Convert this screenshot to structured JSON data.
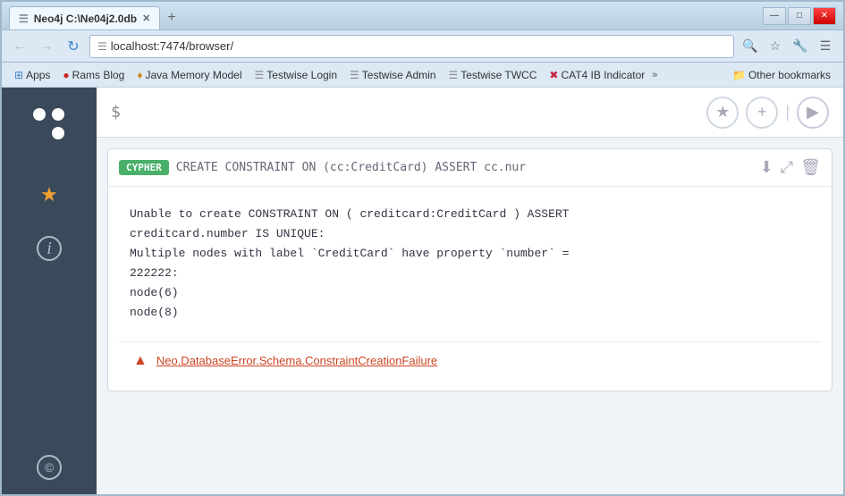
{
  "window": {
    "title": "Neo4j C:\\Ne04j2.0db",
    "tab_label": "Neo4j C:\\Ne04j2.0db",
    "url": "localhost:7474/browser/"
  },
  "bookmarks": {
    "items": [
      {
        "id": "apps",
        "icon": "⊞",
        "label": "Apps",
        "color": "#4488cc"
      },
      {
        "id": "rams-blog",
        "icon": "●",
        "label": "Rams Blog",
        "color": "#cc2222"
      },
      {
        "id": "java-memory",
        "icon": "♦",
        "label": "Java Memory Model",
        "color": "#cc8822"
      },
      {
        "id": "testwise-login",
        "icon": "☰",
        "label": "Testwise Login"
      },
      {
        "id": "testwise-admin",
        "icon": "☰",
        "label": "Testwise Admin"
      },
      {
        "id": "testwise-twcc",
        "icon": "☰",
        "label": "Testwise TWCC"
      },
      {
        "id": "cat4",
        "icon": "✖",
        "label": "CAT4 IB Indicator"
      }
    ],
    "more_label": "»",
    "folder_label": "Other bookmarks"
  },
  "sidebar": {
    "logo_alt": "Neo4j logo",
    "items": [
      {
        "id": "favorites",
        "icon": "★",
        "label": "Favorites",
        "active": true
      },
      {
        "id": "info",
        "icon": "ℹ",
        "label": "Info",
        "active": false
      }
    ],
    "bottom_icon": "©"
  },
  "query_bar": {
    "prompt": "$",
    "star_label": "★",
    "plus_label": "+",
    "play_label": "▶"
  },
  "result": {
    "cypher_badge": "CYPHER",
    "query_text": "CREATE CONSTRAINT ON (cc:CreditCard) ASSERT cc.nur",
    "actions": {
      "download": "⬇",
      "expand": "⤢",
      "delete": "🗑"
    },
    "output_lines": [
      "Unable to create CONSTRAINT ON ( creditcard:CreditCard ) ASSERT",
      "creditcard.number IS UNIQUE:",
      "Multiple nodes with label `CreditCard` have property `number` =",
      "222222:",
      "  node(6)",
      "  node(8)"
    ],
    "error": {
      "icon": "▲",
      "text": "Neo.DatabaseError.Schema.ConstraintCreationFailure"
    }
  },
  "window_controls": {
    "minimize": "—",
    "maximize": "□",
    "close": "✕"
  }
}
